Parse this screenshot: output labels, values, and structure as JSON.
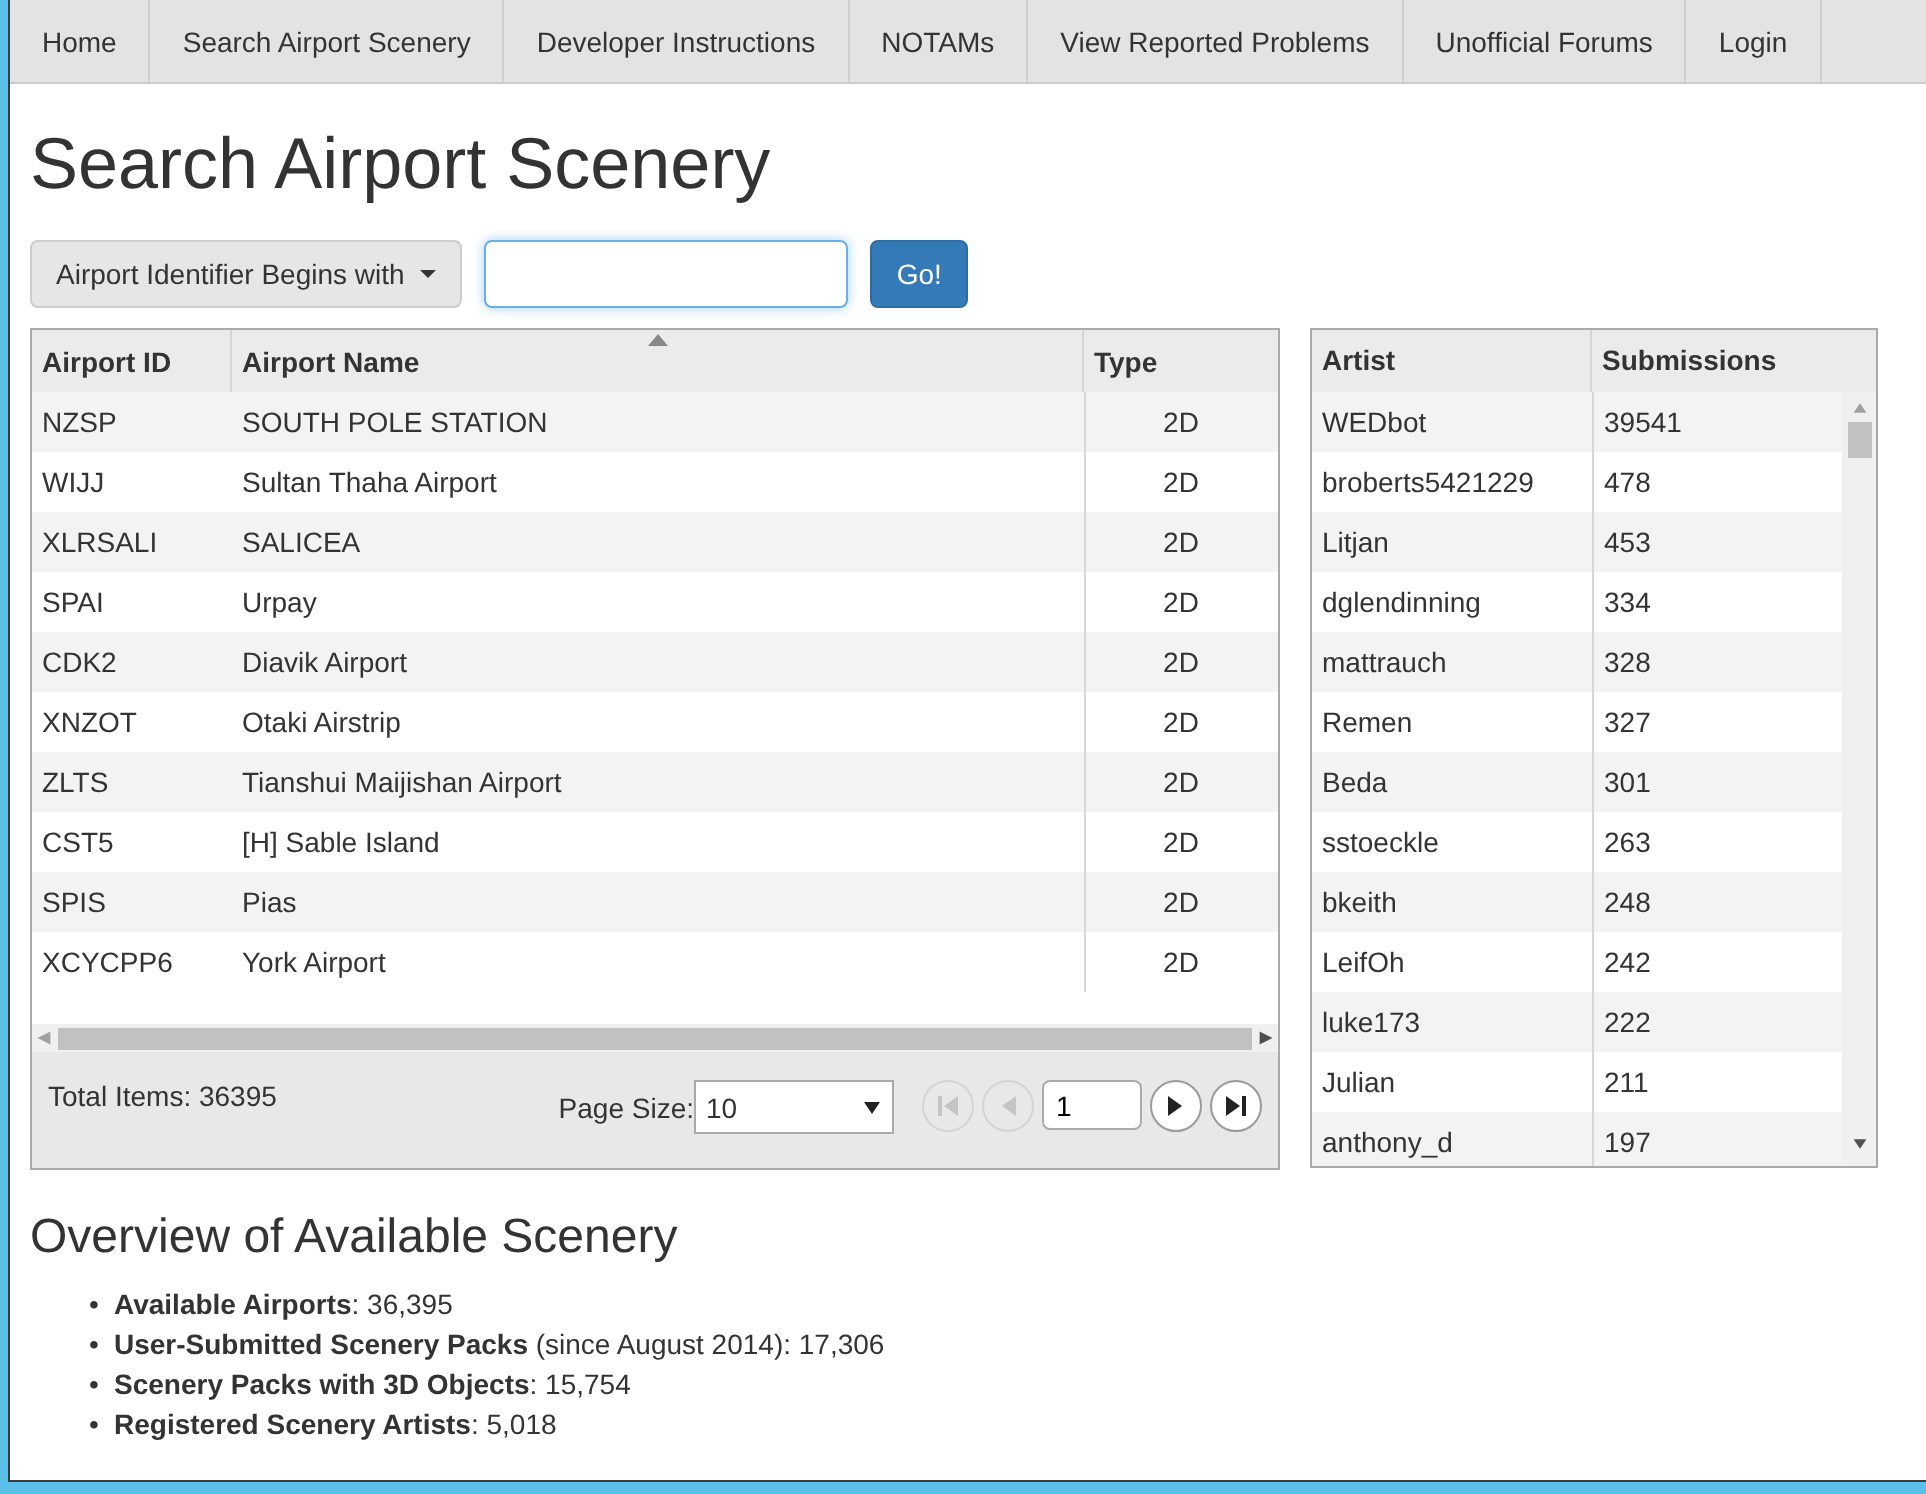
{
  "nav": [
    {
      "label": "Home"
    },
    {
      "label": "Search Airport Scenery"
    },
    {
      "label": "Developer Instructions"
    },
    {
      "label": "NOTAMs"
    },
    {
      "label": "View Reported Problems"
    },
    {
      "label": "Unofficial Forums"
    },
    {
      "label": "Login"
    }
  ],
  "title": "Search Airport Scenery",
  "search": {
    "filter": "Airport Identifier Begins with",
    "button": "Go!"
  },
  "airports": {
    "columns": [
      {
        "label": "Airport ID",
        "sorted": false
      },
      {
        "label": "Airport Name",
        "sorted": true
      },
      {
        "label": "Type",
        "sorted": false
      }
    ],
    "rows": [
      [
        "NZSP",
        "SOUTH POLE STATION",
        "2D"
      ],
      [
        "WIJJ",
        "Sultan Thaha Airport",
        "2D"
      ],
      [
        "XLRSALI",
        "SALICEA",
        "2D"
      ],
      [
        "SPAI",
        "Urpay",
        "2D"
      ],
      [
        "CDK2",
        "Diavik Airport",
        "2D"
      ],
      [
        "XNZOT",
        "Otaki Airstrip",
        "2D"
      ],
      [
        "ZLTS",
        "Tianshui Maijishan Airport",
        "2D"
      ],
      [
        "CST5",
        "[H] Sable Island",
        "2D"
      ],
      [
        "SPIS",
        "Pias",
        "2D"
      ],
      [
        "XCYCPP6",
        "York Airport",
        "2D"
      ]
    ],
    "total": "Total Items: 36395",
    "page_size_label": "Page Size:",
    "page_size": "10",
    "page": "1",
    "pager": [
      {
        "kind": "first",
        "disabled": true
      },
      {
        "kind": "prev",
        "disabled": true
      },
      {
        "kind": "next",
        "disabled": false
      },
      {
        "kind": "last",
        "disabled": false
      }
    ]
  },
  "artists": {
    "columns": [
      "Artist",
      "Submissions"
    ],
    "rows": [
      [
        "WEDbot",
        "39541"
      ],
      [
        "broberts5421229",
        "478"
      ],
      [
        "Litjan",
        "453"
      ],
      [
        "dglendinning",
        "334"
      ],
      [
        "mattrauch",
        "328"
      ],
      [
        "Remen",
        "327"
      ],
      [
        "Beda",
        "301"
      ],
      [
        "sstoeckle",
        "263"
      ],
      [
        "bkeith",
        "248"
      ],
      [
        "LeifOh",
        "242"
      ],
      [
        "luke173",
        "222"
      ],
      [
        "Julian",
        "211"
      ],
      [
        "anthony_d",
        "197"
      ]
    ]
  },
  "overview": {
    "heading": "Overview of Available Scenery",
    "items": [
      {
        "marker": "•",
        "text": "**Available Airports**: 36,395"
      },
      {
        "marker": "•",
        "text": "**User-Submitted Scenery Packs** (since August 2014): 17,306"
      },
      {
        "marker": "•",
        "text": "**Scenery Packs with 3D Objects**: 15,754"
      },
      {
        "marker": "•",
        "text": "**Registered Scenery Artists**: 5,018"
      }
    ]
  }
}
